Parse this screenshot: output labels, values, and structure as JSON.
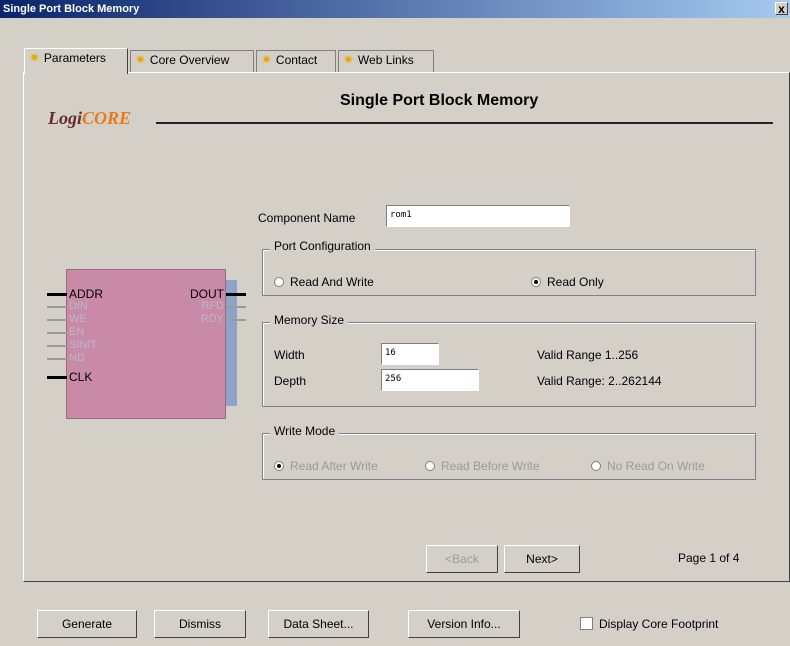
{
  "window": {
    "title": "Single Port Block Memory",
    "close_glyph": "x"
  },
  "tabs": [
    {
      "label": "Parameters",
      "active": true
    },
    {
      "label": "Core Overview",
      "active": false
    },
    {
      "label": "Contact",
      "active": false
    },
    {
      "label": "Web Links",
      "active": false
    }
  ],
  "logo": {
    "text_a": "Logi",
    "text_b": "CORE"
  },
  "heading": "Single Port Block Memory",
  "component": {
    "label": "Component Name",
    "value": "rom1"
  },
  "port_config": {
    "title": "Port Configuration",
    "options": [
      "Read And Write",
      "Read Only"
    ],
    "selected": "Read Only"
  },
  "memory_size": {
    "title": "Memory Size",
    "width_label": "Width",
    "width_value": "16",
    "width_range": "Valid Range 1..256",
    "depth_label": "Depth",
    "depth_value": "256",
    "depth_range": "Valid Range: 2..262144"
  },
  "write_mode": {
    "title": "Write Mode",
    "options": [
      "Read After Write",
      "Read Before Write",
      "No Read On Write"
    ],
    "selected": "Read After Write",
    "enabled": false
  },
  "nav": {
    "back": "<Back",
    "next": "Next>",
    "page": "Page 1 of 4"
  },
  "symbol": {
    "left_pins": [
      {
        "name": "ADDR",
        "active": true
      },
      {
        "name": "DIN",
        "active": false
      },
      {
        "name": "WE",
        "active": false
      },
      {
        "name": "EN",
        "active": false
      },
      {
        "name": "SINIT",
        "active": false
      },
      {
        "name": "ND",
        "active": false
      },
      {
        "name": "CLK",
        "active": true
      }
    ],
    "right_pins": [
      {
        "name": "DOUT",
        "active": true
      },
      {
        "name": "RFD",
        "active": false
      },
      {
        "name": "RDY",
        "active": false
      }
    ]
  },
  "footer": {
    "generate": "Generate",
    "dismiss": "Dismiss",
    "datasheet": "Data Sheet...",
    "version": "Version Info...",
    "footprint": "Display Core Footprint"
  },
  "colors": {
    "block": "#c88aa7",
    "shadow": "#8ea3c5",
    "title_bar": "#0a246a"
  },
  "icons": {
    "tab_icon": "lightbulb-star-icon"
  }
}
